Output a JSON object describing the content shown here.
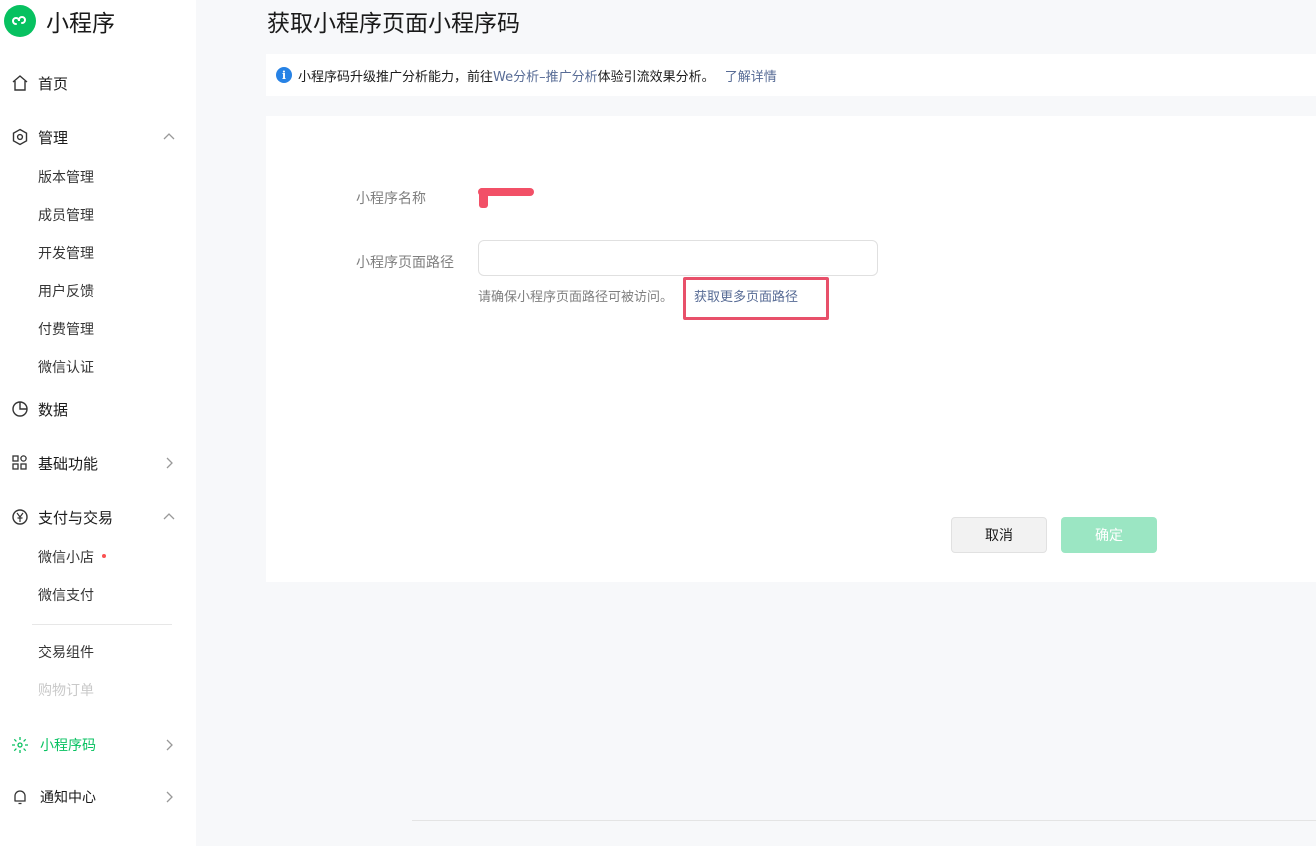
{
  "brand": {
    "title": "小程序"
  },
  "sidebar": {
    "home": "首页",
    "manage": {
      "label": "管理",
      "items": [
        "版本管理",
        "成员管理",
        "开发管理",
        "用户反馈",
        "付费管理",
        "微信认证"
      ]
    },
    "data": "数据",
    "basic": "基础功能",
    "pay": {
      "label": "支付与交易",
      "items": [
        "微信小店",
        "微信支付"
      ],
      "items2": [
        "交易组件",
        "购物订单"
      ]
    },
    "qrcode": "小程序码",
    "notice": "通知中心"
  },
  "page": {
    "title": "获取小程序页面小程序码"
  },
  "notice": {
    "prefix": "小程序码升级推广分析能力，前往",
    "link": "We分析–推广分析",
    "suffix": "体验引流效果分析。",
    "more": "了解详情"
  },
  "form": {
    "name_label": "小程序名称",
    "path_label": "小程序页面路径",
    "path_value": "",
    "hint": "请确保小程序页面路径可被访问。",
    "hint_link": "获取更多页面路径",
    "cancel": "取消",
    "confirm": "确定"
  },
  "colors": {
    "accent": "#07c160",
    "link": "#576b95",
    "highlight": "#e8506a"
  }
}
